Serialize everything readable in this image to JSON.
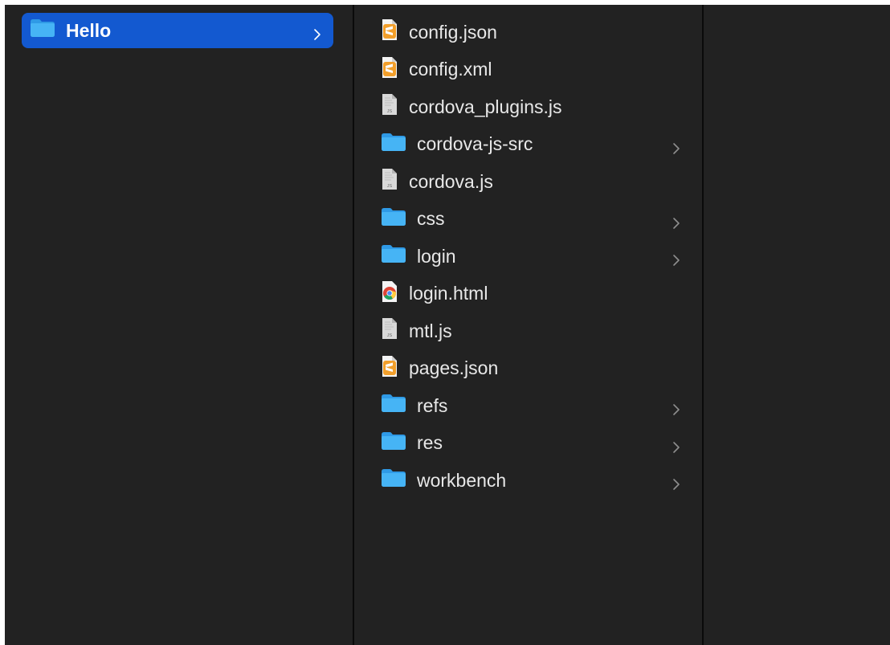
{
  "sidebar": {
    "items": [
      {
        "label": "Hello",
        "icon": "folder-icon",
        "selected": true,
        "has_children": true
      }
    ]
  },
  "files": {
    "items": [
      {
        "label": "config.json",
        "icon": "sublime-doc-icon",
        "has_children": false
      },
      {
        "label": "config.xml",
        "icon": "sublime-doc-icon",
        "has_children": false
      },
      {
        "label": "cordova_plugins.js",
        "icon": "js-file-icon",
        "has_children": false
      },
      {
        "label": "cordova-js-src",
        "icon": "folder-icon",
        "has_children": true
      },
      {
        "label": "cordova.js",
        "icon": "js-file-icon",
        "has_children": false
      },
      {
        "label": "css",
        "icon": "folder-icon",
        "has_children": true
      },
      {
        "label": "login",
        "icon": "folder-icon",
        "has_children": true
      },
      {
        "label": "login.html",
        "icon": "chrome-doc-icon",
        "has_children": false
      },
      {
        "label": "mtl.js",
        "icon": "js-file-icon",
        "has_children": false
      },
      {
        "label": "pages.json",
        "icon": "sublime-doc-icon",
        "has_children": false
      },
      {
        "label": "refs",
        "icon": "folder-icon",
        "has_children": true
      },
      {
        "label": "res",
        "icon": "folder-icon",
        "has_children": true
      },
      {
        "label": "workbench",
        "icon": "folder-icon",
        "has_children": true
      }
    ]
  },
  "icon_text": {
    "js": "JS"
  },
  "colors": {
    "background": "#222222",
    "selection": "#1359d0",
    "folder": "#3ea8ef",
    "text": "#e8e8e8",
    "chevron": "#8e8e8e"
  }
}
